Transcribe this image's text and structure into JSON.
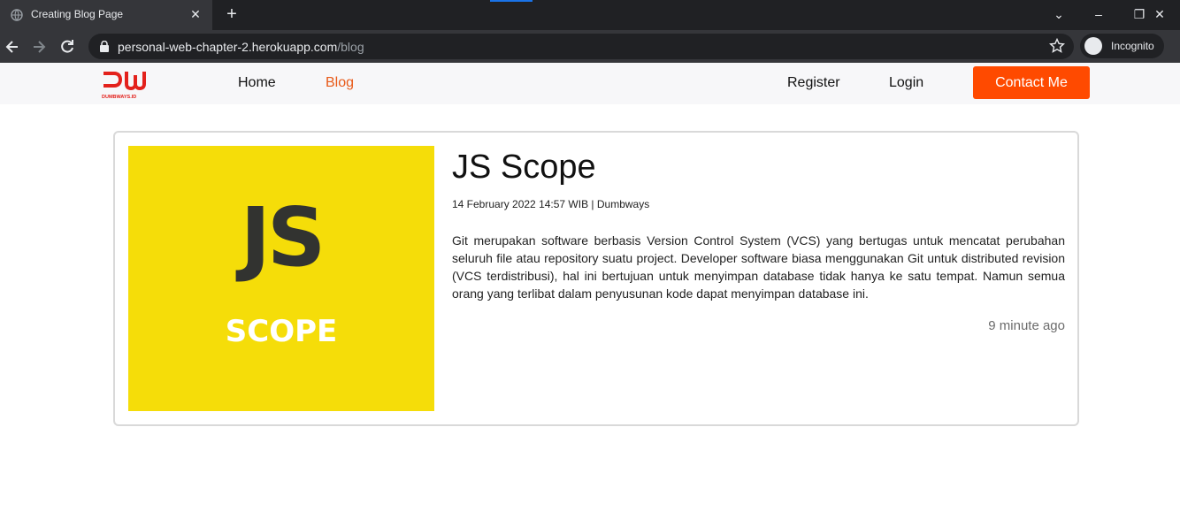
{
  "browser": {
    "tab_title": "Creating Blog Page",
    "url_host": "personal-web-chapter-2.herokuapp.com",
    "url_path": "/blog",
    "incognito_label": "Incognito"
  },
  "navbar": {
    "logo_alt": "DUMBWAYS.ID",
    "links": [
      {
        "label": "Home"
      },
      {
        "label": "Blog"
      },
      {
        "label": "Register"
      },
      {
        "label": "Login"
      }
    ],
    "contact_label": "Contact Me",
    "active_color": "#e85a19",
    "brand_color": "#ff4a00"
  },
  "post": {
    "thumbnail_text_main": "JS",
    "thumbnail_text_sub": "SCOPE",
    "title": "JS Scope",
    "meta": "14 February 2022 14:57 WIB | Dumbways",
    "body": "Git merupakan software berbasis Version Control System (VCS) yang bertugas untuk mencatat perubahan seluruh file atau repository suatu project. Developer software biasa menggunakan Git untuk distributed revision (VCS terdistribusi), hal ini bertujuan untuk menyimpan database tidak hanya ke satu tempat. Namun semua orang yang terlibat dalam penyusunan kode dapat menyimpan database ini.",
    "time_ago": "9 minute ago"
  }
}
